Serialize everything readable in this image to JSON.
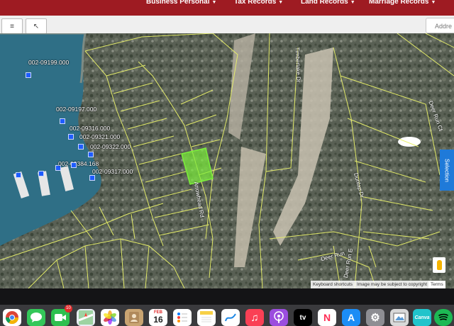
{
  "nav": {
    "items": [
      {
        "label": "Business Personal"
      },
      {
        "label": "Tax Records"
      },
      {
        "label": "Land Records"
      },
      {
        "label": "Marriage Records"
      }
    ]
  },
  "browser": {
    "address_partial": "Addre"
  },
  "map": {
    "parcel_labels": [
      "002-09199.000",
      "002-09197.000",
      "002-09316.000",
      "002-09321.000",
      "002-09322.000",
      "002-09384.168",
      "002-09317.000"
    ],
    "road_labels": [
      "Arrowhead Rd",
      "Timberlake Dr",
      "Deer Run Ct",
      "Deer Run",
      "Deer Run E",
      "Dunlap Dr",
      "Airport Rd E"
    ],
    "selection_tab": "Selection",
    "zoom_in": "+",
    "zoom_out": "−",
    "attribution": [
      "Keyboard shortcuts",
      "Image may be subject to copyright",
      "Terms"
    ],
    "highlight_color": "#7cf03a",
    "parcel_line_color": "#e8f06a",
    "water_color": "#2f6f86"
  },
  "dock": {
    "items": [
      {
        "name": "chrome-icon",
        "glyph": ""
      },
      {
        "name": "messages-icon",
        "glyph": ""
      },
      {
        "name": "facetime-icon",
        "glyph": ""
      },
      {
        "name": "maps-icon",
        "glyph": ""
      },
      {
        "name": "photos-icon",
        "glyph": ""
      },
      {
        "name": "contacts-icon",
        "glyph": ""
      },
      {
        "name": "calendar-icon",
        "glyph": "16",
        "month": "FEB"
      },
      {
        "name": "reminders-icon",
        "glyph": ""
      },
      {
        "name": "notes-icon",
        "glyph": ""
      },
      {
        "name": "freeform-icon",
        "glyph": ""
      },
      {
        "name": "music-icon",
        "glyph": "♫"
      },
      {
        "name": "podcasts-icon",
        "glyph": ""
      },
      {
        "name": "tv-icon",
        "glyph": "tv"
      },
      {
        "name": "news-icon",
        "glyph": "N"
      },
      {
        "name": "app-store-icon",
        "glyph": "A"
      },
      {
        "name": "system-settings-icon",
        "glyph": "⚙"
      },
      {
        "name": "preview-icon",
        "glyph": ""
      },
      {
        "name": "canva-icon",
        "glyph": "Canva"
      },
      {
        "name": "spotify-icon",
        "glyph": ""
      }
    ],
    "facetime_badge": "10"
  }
}
